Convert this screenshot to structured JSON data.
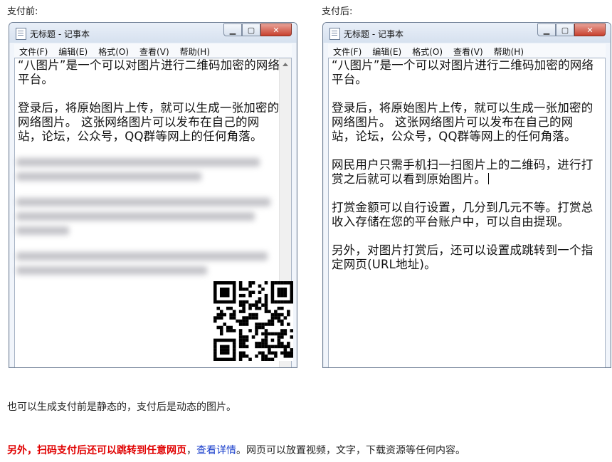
{
  "left": {
    "caption": "支付前:",
    "window_title": "无标题 - 记事本",
    "menu": [
      "文件(F)",
      "编辑(E)",
      "格式(O)",
      "查看(V)",
      "帮助(H)"
    ],
    "paragraphs": [
      "“八图片”是一个可以对图片进行二维码加密的网络平台。",
      "登录后，将原始图片上传，就可以生成一张加密的网络图片。 这张网络图片可以发布在自己的网站，论坛，公众号，QQ群等网上的任何角落。"
    ]
  },
  "right": {
    "caption": "支付后:",
    "window_title": "无标题 - 记事本",
    "menu": [
      "文件(F)",
      "编辑(E)",
      "格式(O)",
      "查看(V)",
      "帮助(H)"
    ],
    "paragraphs": [
      "“八图片”是一个可以对图片进行二维码加密的网络平台。",
      "登录后，将原始图片上传，就可以生成一张加密的网络图片。 这张网络图片可以发布在自己的网站，论坛，公众号，QQ群等网上的任何角落。",
      "网民用户只需手机扫一扫图片上的二维码，进行打赏之后就可以看到原始图片。",
      "打赏金额可以自行设置，几分到几元不等。打赏总收入存储在您的平台账户中，可以自由提现。",
      "另外，对图片打赏后，还可以设置成跳转到一个指定网页(URL地址)。"
    ]
  },
  "note1": "也可以生成支付前是静态的，支付后是动态的图片。",
  "note2": {
    "red": "另外，扫码支付后还可以跳转到任意网页",
    "comma": "，",
    "link": "查看详情",
    "rest": "。网页可以放置视频，文字，下载资源等任何内容。"
  },
  "icons": {
    "min": "minimize-icon",
    "max": "maximize-icon",
    "close": "close-icon"
  }
}
